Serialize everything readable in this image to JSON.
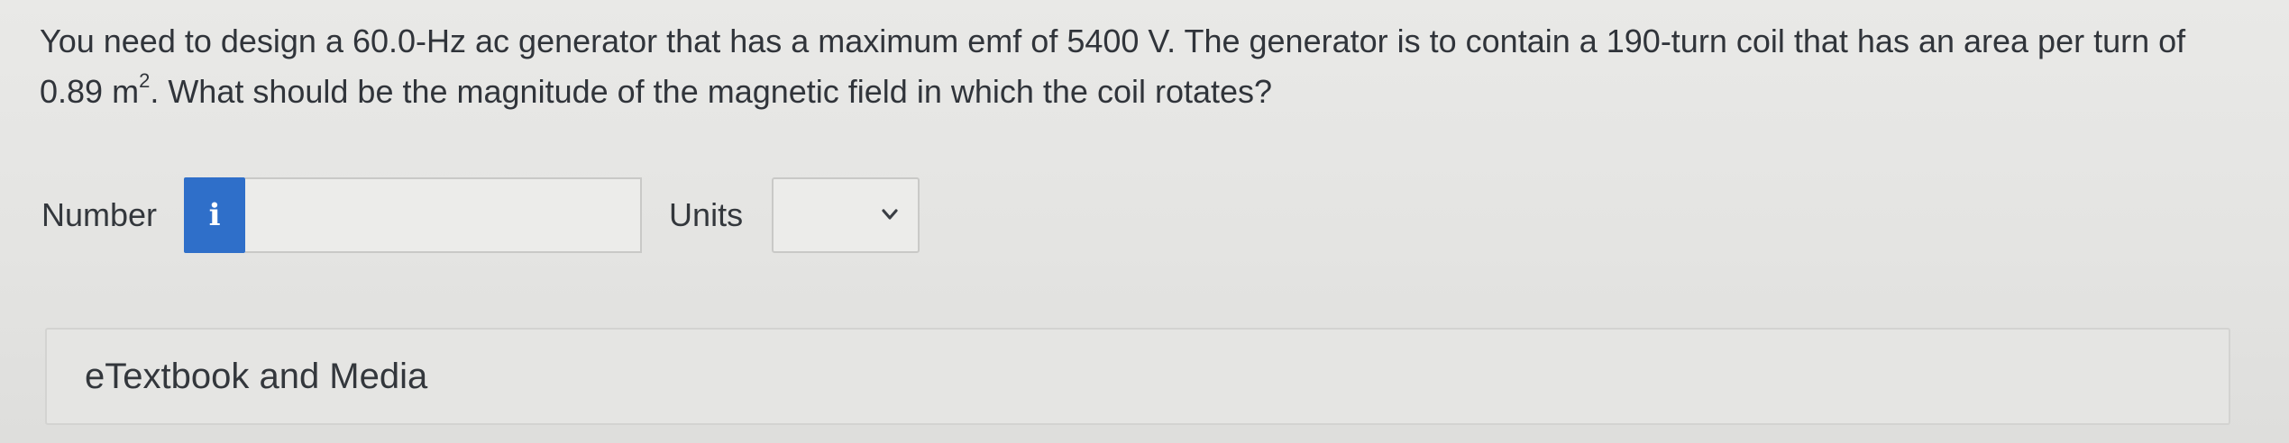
{
  "question": {
    "text_part1": "You need to design a 60.0-Hz ac generator that has a maximum emf of 5400 V. The generator is to contain a 190-turn coil that has an area per turn of 0.89 m",
    "superscript": "2",
    "text_part2": ". What should be the magnitude of the magnetic field in which the coil rotates?"
  },
  "answer": {
    "number_label": "Number",
    "info_icon_glyph": "i",
    "number_value": "",
    "units_label": "Units",
    "units_selected": ""
  },
  "resources": {
    "etextbook_label": "eTextbook and Media"
  },
  "colors": {
    "accent": "#2f6fc9",
    "background": "#e6e6e4",
    "text": "#30343a"
  }
}
